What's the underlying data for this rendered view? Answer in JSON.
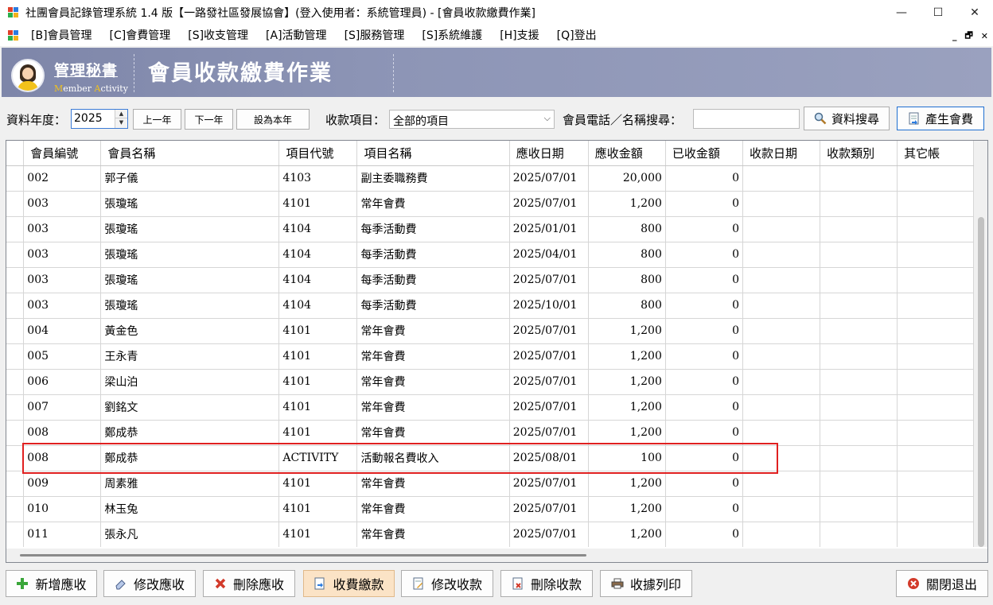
{
  "window": {
    "title": "社團會員記錄管理系統 1.4 版【一路發社區發展協會】(登入使用者：系統管理員) - [會員收款繳費作業]",
    "minimize": "—",
    "maximize": "☐",
    "close": "✕"
  },
  "menu": {
    "items": [
      "[B]會員管理",
      "[C]會費管理",
      "[S]收支管理",
      "[A]活動管理",
      "[S]服務管理",
      "[S]系統維護",
      "[H]支援",
      "[Q]登出"
    ],
    "mdi_min": "_",
    "mdi_restore": "🗗",
    "mdi_close": "✕"
  },
  "banner": {
    "brand_title": "管理秘書",
    "brand_sub_m": "M",
    "brand_sub_1": "ember ",
    "brand_sub_a": "A",
    "brand_sub_2": "ctivity",
    "page_title": "會員收款繳費作業"
  },
  "toolbar": {
    "year_label": "資料年度：",
    "year_value": "2025",
    "prev_year": "上一年",
    "next_year": "下一年",
    "set_this_year": "設為本年",
    "item_label": "收款項目：",
    "item_selected": "全部的項目",
    "search_label": "會員電話／名稱搜尋：",
    "search_value": "",
    "search_button": "資料搜尋",
    "generate_button": "產生會費"
  },
  "grid": {
    "columns": [
      "會員編號",
      "會員名稱",
      "項目代號",
      "項目名稱",
      "應收日期",
      "應收金額",
      "已收金額",
      "收款日期",
      "收款類別",
      "其它帳"
    ],
    "rows": [
      [
        "002",
        "郭子儀",
        "4103",
        "副主委職務費",
        "2025/07/01",
        "20,000",
        "0",
        "",
        "",
        ""
      ],
      [
        "003",
        "張瓊瑤",
        "4101",
        "常年會費",
        "2025/07/01",
        "1,200",
        "0",
        "",
        "",
        ""
      ],
      [
        "003",
        "張瓊瑤",
        "4104",
        "每季活動費",
        "2025/01/01",
        "800",
        "0",
        "",
        "",
        ""
      ],
      [
        "003",
        "張瓊瑤",
        "4104",
        "每季活動費",
        "2025/04/01",
        "800",
        "0",
        "",
        "",
        ""
      ],
      [
        "003",
        "張瓊瑤",
        "4104",
        "每季活動費",
        "2025/07/01",
        "800",
        "0",
        "",
        "",
        ""
      ],
      [
        "003",
        "張瓊瑤",
        "4104",
        "每季活動費",
        "2025/10/01",
        "800",
        "0",
        "",
        "",
        ""
      ],
      [
        "004",
        "黃金色",
        "4101",
        "常年會費",
        "2025/07/01",
        "1,200",
        "0",
        "",
        "",
        ""
      ],
      [
        "005",
        "王永青",
        "4101",
        "常年會費",
        "2025/07/01",
        "1,200",
        "0",
        "",
        "",
        ""
      ],
      [
        "006",
        "梁山泊",
        "4101",
        "常年會費",
        "2025/07/01",
        "1,200",
        "0",
        "",
        "",
        ""
      ],
      [
        "007",
        "劉銘文",
        "4101",
        "常年會費",
        "2025/07/01",
        "1,200",
        "0",
        "",
        "",
        ""
      ],
      [
        "008",
        "鄭成恭",
        "4101",
        "常年會費",
        "2025/07/01",
        "1,200",
        "0",
        "",
        "",
        ""
      ],
      [
        "008",
        "鄭成恭",
        "ACTIVITY",
        "活動報名費收入",
        "2025/08/01",
        "100",
        "0",
        "",
        "",
        ""
      ],
      [
        "009",
        "周素雅",
        "4101",
        "常年會費",
        "2025/07/01",
        "1,200",
        "0",
        "",
        "",
        ""
      ],
      [
        "010",
        "林玉兔",
        "4101",
        "常年會費",
        "2025/07/01",
        "1,200",
        "0",
        "",
        "",
        ""
      ],
      [
        "011",
        "張永凡",
        "4101",
        "常年會費",
        "2025/07/01",
        "1,200",
        "0",
        "",
        "",
        ""
      ]
    ]
  },
  "actions": {
    "add": "新增應收",
    "edit": "修改應收",
    "delete": "刪除應收",
    "collect": "收費繳款",
    "edit_payment": "修改收款",
    "delete_payment": "刪除收款",
    "print_receipt": "收據列印",
    "exit": "關閉退出"
  }
}
